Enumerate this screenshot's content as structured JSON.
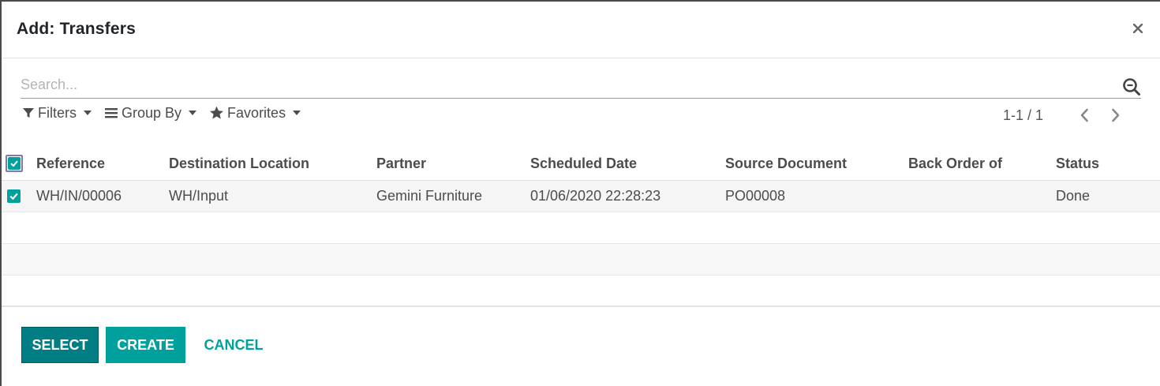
{
  "dialog": {
    "title": "Add: Transfers",
    "close_icon": "close-icon"
  },
  "search": {
    "placeholder": "Search...",
    "value": "",
    "icon": "search-icon"
  },
  "filters": {
    "filters_label": "Filters",
    "group_by_label": "Group By",
    "favorites_label": "Favorites"
  },
  "pager": {
    "value": "1-1 / 1",
    "prev_icon": "chevron-left-icon",
    "next_icon": "chevron-right-icon"
  },
  "table": {
    "columns": [
      "Reference",
      "Destination Location",
      "Partner",
      "Scheduled Date",
      "Source Document",
      "Back Order of",
      "Status"
    ],
    "rows": [
      {
        "selected": true,
        "reference": "WH/IN/00006",
        "destination": "WH/Input",
        "partner": "Gemini Furniture",
        "scheduled_date": "01/06/2020 22:28:23",
        "source_document": "PO00008",
        "back_order_of": "",
        "status": "Done"
      }
    ]
  },
  "footer": {
    "select_label": "Select",
    "create_label": "Create",
    "cancel_label": "Cancel"
  },
  "colors": {
    "primary": "#017e84",
    "accent": "#00A09D",
    "text": "#4c4c4c"
  }
}
